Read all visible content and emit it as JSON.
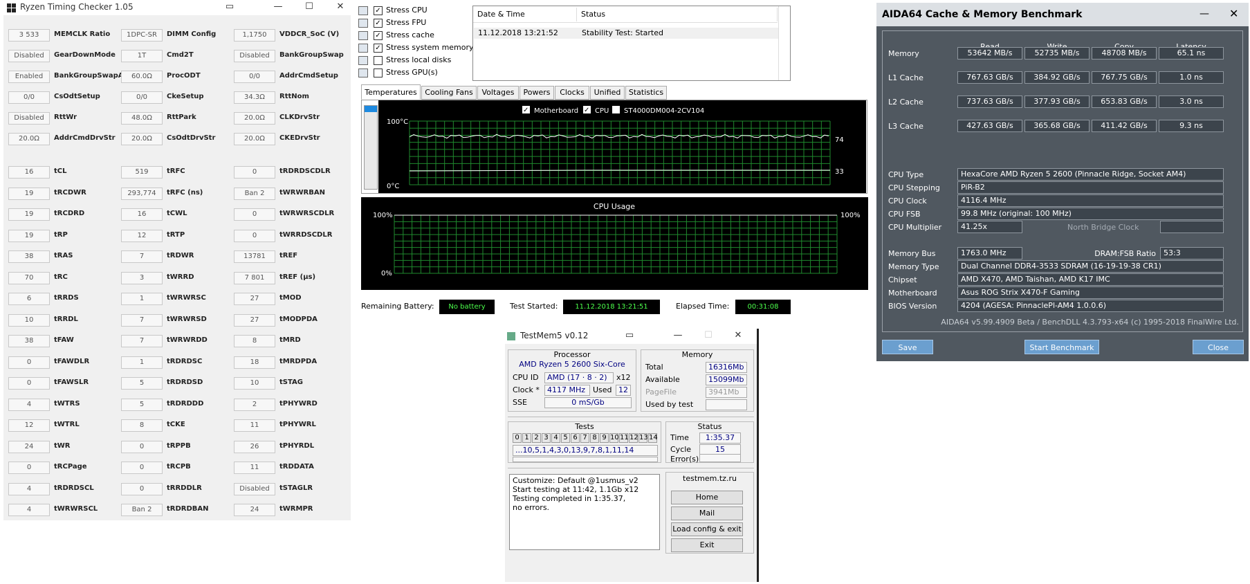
{
  "rtc": {
    "title": "Ryzen Timing Checker 1.05",
    "rows": [
      [
        [
          "3 533",
          "MEMCLK Ratio"
        ],
        [
          "1DPC-SR",
          "DIMM Config"
        ],
        [
          "1,1750",
          "VDDCR_SoC (V)"
        ]
      ],
      [
        [
          "Disabled",
          "GearDownMode"
        ],
        [
          "1T",
          "Cmd2T"
        ],
        [
          "Disabled",
          "BankGroupSwap"
        ]
      ],
      [
        [
          "Enabled",
          "BankGroupSwapAlt"
        ],
        [
          "60.0Ω",
          "ProcODT"
        ],
        [
          "0/0",
          "AddrCmdSetup"
        ]
      ],
      [
        [
          "0/0",
          "CsOdtSetup"
        ],
        [
          "0/0",
          "CkeSetup"
        ],
        [
          "34.3Ω",
          "RttNom"
        ]
      ],
      [
        [
          "Disabled",
          "RttWr"
        ],
        [
          "48.0Ω",
          "RttPark"
        ],
        [
          "20.0Ω",
          "CLKDrvStr"
        ]
      ],
      [
        [
          "20.0Ω",
          "AddrCmdDrvStr"
        ],
        [
          "20.0Ω",
          "CsOdtDrvStr"
        ],
        [
          "20.0Ω",
          "CKEDrvStr"
        ]
      ],
      [
        [
          "16",
          "tCL"
        ],
        [
          "519",
          "tRFC"
        ],
        [
          "0",
          "tRDRDSCDLR"
        ]
      ],
      [
        [
          "19",
          "tRCDWR"
        ],
        [
          "293,774",
          "tRFC (ns)"
        ],
        [
          "Ban 2",
          "tWRWRBAN"
        ]
      ],
      [
        [
          "19",
          "tRCDRD"
        ],
        [
          "16",
          "tCWL"
        ],
        [
          "0",
          "tWRWRSCDLR"
        ]
      ],
      [
        [
          "19",
          "tRP"
        ],
        [
          "12",
          "tRTP"
        ],
        [
          "0",
          "tWRRDSCDLR"
        ]
      ],
      [
        [
          "38",
          "tRAS"
        ],
        [
          "7",
          "tRDWR"
        ],
        [
          "13781",
          "tREF"
        ]
      ],
      [
        [
          "70",
          "tRC"
        ],
        [
          "3",
          "tWRRD"
        ],
        [
          "7 801",
          "tREF (µs)"
        ]
      ],
      [
        [
          "6",
          "tRRDS"
        ],
        [
          "1",
          "tWRWRSC"
        ],
        [
          "27",
          "tMOD"
        ]
      ],
      [
        [
          "10",
          "tRRDL"
        ],
        [
          "7",
          "tWRWRSD"
        ],
        [
          "27",
          "tMODPDA"
        ]
      ],
      [
        [
          "38",
          "tFAW"
        ],
        [
          "7",
          "tWRWRDD"
        ],
        [
          "8",
          "tMRD"
        ]
      ],
      [
        [
          "0",
          "tFAWDLR"
        ],
        [
          "1",
          "tRDRDSC"
        ],
        [
          "18",
          "tMRDPDA"
        ]
      ],
      [
        [
          "0",
          "tFAWSLR"
        ],
        [
          "5",
          "tRDRDSD"
        ],
        [
          "10",
          "tSTAG"
        ]
      ],
      [
        [
          "4",
          "tWTRS"
        ],
        [
          "5",
          "tRDRDDD"
        ],
        [
          "2",
          "tPHYWRD"
        ]
      ],
      [
        [
          "12",
          "tWTRL"
        ],
        [
          "8",
          "tCKE"
        ],
        [
          "11",
          "tPHYWRL"
        ]
      ],
      [
        [
          "24",
          "tWR"
        ],
        [
          "0",
          "tRPPB"
        ],
        [
          "26",
          "tPHYRDL"
        ]
      ],
      [
        [
          "0",
          "tRCPage"
        ],
        [
          "0",
          "tRCPB"
        ],
        [
          "11",
          "tRDDATA"
        ]
      ],
      [
        [
          "4",
          "tRDRDSCL"
        ],
        [
          "0",
          "tRRDDLR"
        ],
        [
          "Disabled",
          "tSTAGLR"
        ]
      ],
      [
        [
          "4",
          "tWRWRSCL"
        ],
        [
          "Ban 2",
          "tRDRDBAN"
        ],
        [
          "24",
          "tWRMPR"
        ]
      ]
    ]
  },
  "stress": {
    "options": [
      {
        "label": "Stress CPU",
        "checked": true
      },
      {
        "label": "Stress FPU",
        "checked": true
      },
      {
        "label": "Stress cache",
        "checked": true
      },
      {
        "label": "Stress system memory",
        "checked": true
      },
      {
        "label": "Stress local disks",
        "checked": false
      },
      {
        "label": "Stress GPU(s)",
        "checked": false
      }
    ],
    "table": {
      "col_datetime": "Date & Time",
      "col_status": "Status",
      "row_datetime": "11.12.2018 13:21:52",
      "row_status": "Stability Test: Started"
    },
    "tabs": [
      "Temperatures",
      "Cooling Fans",
      "Voltages",
      "Powers",
      "Clocks",
      "Unified",
      "Statistics"
    ],
    "temp_legend": [
      {
        "label": "Motherboard",
        "checked": true
      },
      {
        "label": "CPU",
        "checked": true
      },
      {
        "label": "ST4000DM004-2CV104",
        "checked": false
      }
    ],
    "temp_top": "100°C",
    "temp_bottom": "0°C",
    "temp_value_1": "74",
    "temp_value_2": "33",
    "cpu_title": "CPU Usage",
    "cpu_top_left": "100%",
    "cpu_top_right": "100%",
    "cpu_bottom": "0%",
    "battery_label": "Remaining Battery:",
    "battery_value": "No battery",
    "started_label": "Test Started:",
    "started_value": "11.12.2018 13:21:51",
    "elapsed_label": "Elapsed Time:",
    "elapsed_value": "00:31:08"
  },
  "tm5": {
    "title": "TestMem5 v0.12",
    "processor_title": "Processor",
    "cpu_name": "AMD Ryzen 5 2600 Six-Core",
    "cpuid_label": "CPU ID",
    "cpuid_value": "AMD  (17 · 8 · 2)",
    "cpuid_count": "x12",
    "clock_label": "Clock *",
    "clock_value": "4117 MHz",
    "used_label": "Used",
    "used_value": "12",
    "sse_label": "SSE",
    "sse_value": "0 mS/Gb",
    "memory_title": "Memory",
    "total_label": "Total",
    "total_value": "16316Mb",
    "available_label": "Available",
    "available_value": "15099Mb",
    "pagefile_label": "PageFile",
    "pagefile_value": "3941Mb",
    "usedbytest_label": "Used by test",
    "tests_title": "Tests",
    "test_numbers": [
      "0",
      "1",
      "2",
      "3",
      "4",
      "5",
      "6",
      "7",
      "8",
      "9",
      "10",
      "11",
      "12",
      "13",
      "14"
    ],
    "test_sequence": "...10,5,1,4,3,0,13,9,7,8,1,11,14",
    "status_title": "Status",
    "time_label": "Time",
    "time_value": "1:35.37",
    "cycle_label": "Cycle",
    "cycle_value": "15",
    "errors_label": "Error(s)",
    "log": [
      "Customize: Default @1usmus_v2",
      "Start testing at 11:42, 1.1Gb x12",
      "Testing completed in 1:35.37,",
      "no errors."
    ],
    "site": "testmem.tz.ru",
    "btn_home": "Home",
    "btn_mail": "Mail",
    "btn_load": "Load config & exit",
    "btn_exit": "Exit"
  },
  "aida": {
    "title": "AIDA64 Cache & Memory Benchmark",
    "headers": [
      "Read",
      "Write",
      "Copy",
      "Latency"
    ],
    "bench": [
      {
        "label": "Memory",
        "values": [
          "53642 MB/s",
          "52735 MB/s",
          "48708 MB/s",
          "65.1 ns"
        ]
      },
      {
        "label": "L1 Cache",
        "values": [
          "767.63 GB/s",
          "384.92 GB/s",
          "767.75 GB/s",
          "1.0 ns"
        ]
      },
      {
        "label": "L2 Cache",
        "values": [
          "737.63 GB/s",
          "377.93 GB/s",
          "653.83 GB/s",
          "3.0 ns"
        ]
      },
      {
        "label": "L3 Cache",
        "values": [
          "427.63 GB/s",
          "365.68 GB/s",
          "411.42 GB/s",
          "9.3 ns"
        ]
      }
    ],
    "cpu_type_label": "CPU Type",
    "cpu_type": "HexaCore AMD Ryzen 5 2600  (Pinnacle Ridge, Socket AM4)",
    "cpu_stepping_label": "CPU Stepping",
    "cpu_stepping": "PiR-B2",
    "cpu_clock_label": "CPU Clock",
    "cpu_clock": "4116.4 MHz",
    "cpu_fsb_label": "CPU FSB",
    "cpu_fsb": "99.8 MHz  (original: 100 MHz)",
    "cpu_mult_label": "CPU Multiplier",
    "cpu_mult": "41.25x",
    "nb_clock_label": "North Bridge Clock",
    "mem_bus_label": "Memory Bus",
    "mem_bus": "1763.0 MHz",
    "dram_ratio_label": "DRAM:FSB Ratio",
    "dram_ratio": "53:3",
    "mem_type_label": "Memory Type",
    "mem_type": "Dual Channel DDR4-3533 SDRAM  (16-19-19-38 CR1)",
    "chipset_label": "Chipset",
    "chipset": "AMD X470, AMD Taishan, AMD K17 IMC",
    "mobo_label": "Motherboard",
    "mobo": "Asus ROG Strix X470-F Gaming",
    "bios_label": "BIOS Version",
    "bios": "4204  (AGESA: PinnaclePl-AM4 1.0.0.6)",
    "footer": "AIDA64 v5.99.4909 Beta / BenchDLL 4.3.793-x64  (c) 1995-2018 FinalWire Ltd.",
    "btn_save": "Save",
    "btn_start": "Start Benchmark",
    "btn_close": "Close"
  },
  "colors": {
    "graph_grid": "#1f8a2e",
    "graph_line": "#ffffff",
    "aida_bg": "#505860",
    "aida_button": "#6b9fcf",
    "status_green": "#4cff4c"
  }
}
